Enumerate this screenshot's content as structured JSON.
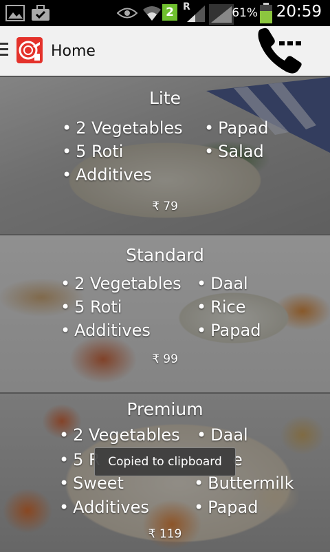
{
  "status_bar": {
    "time": "20:59",
    "battery_percent": "61%",
    "sim_badge": "2",
    "roaming": "R",
    "icons": [
      "image-icon",
      "briefcase-check-icon",
      "eye-icon",
      "wifi-icon",
      "signal-icon",
      "signal-icon",
      "battery-icon"
    ]
  },
  "action_bar": {
    "title": "Home",
    "icons": [
      "menu-icon",
      "app-logo-icon",
      "phone-more-icon"
    ]
  },
  "plans": [
    {
      "name": "Lite",
      "col1": [
        "2 Vegetables",
        "5 Roti",
        "Additives"
      ],
      "col2": [
        "Papad",
        "Salad"
      ],
      "price": "₹ 79"
    },
    {
      "name": "Standard",
      "col1": [
        "2 Vegetables",
        "5 Roti",
        "Additives"
      ],
      "col2": [
        "Daal",
        "Rice",
        "Papad"
      ],
      "price": "₹ 99"
    },
    {
      "name": "Premium",
      "col1": [
        "2 Vegetables",
        "5 R",
        "Sweet",
        "Additives"
      ],
      "col2": [
        "Daal",
        "e",
        "Buttermilk",
        "Papad"
      ],
      "price": "₹ 119"
    }
  ],
  "toast": "Copied to clipboard",
  "colors": {
    "accent": "#e4322b",
    "battery": "#8cc63f",
    "status_bar": "#000000",
    "action_bar": "#f1f1f1"
  }
}
